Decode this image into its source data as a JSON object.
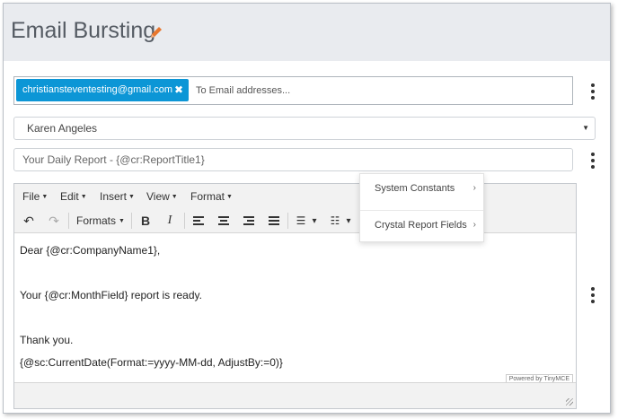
{
  "header": {
    "title": "Email Bursting",
    "edit_icon": "pencil-icon"
  },
  "recipients": {
    "chip_email": "christiansteventesting@gmail.com",
    "chip_remove_glyph": "✖",
    "placeholder": "To Email addresses..."
  },
  "sender": {
    "selected": "Karen Angeles",
    "caret_glyph": "▼"
  },
  "subject": {
    "value": "Your Daily Report -  {@cr:ReportTitle1}"
  },
  "editor": {
    "menus": {
      "file": "File",
      "edit": "Edit",
      "insert": "Insert",
      "view": "View",
      "format": "Format"
    },
    "toolbar": {
      "undo_glyph": "↶",
      "redo_glyph": "↷",
      "formats": "Formats",
      "bold": "B",
      "italic": "I",
      "bullet_glyph": "☰",
      "numbered_glyph": "☷",
      "dropdown_glyph": "▾"
    },
    "body": {
      "line1": "Dear {@cr:CompanyName1},",
      "line2": "Your {@cr:MonthField} report is ready.",
      "line3": "Thank you.",
      "line4": "{@sc:CurrentDate(Format:=yyyy-MM-dd, AdjustBy:=0)}"
    },
    "powered_by": "Powered by TinyMCE"
  },
  "context_menu": {
    "items": [
      {
        "label": "System Constants"
      },
      {
        "label": "Crystal Report Fields"
      }
    ],
    "chevron": "›"
  },
  "colors": {
    "chip": "#0c96d6",
    "header_bg": "#e9ebef",
    "pencil": "#e8772e"
  }
}
